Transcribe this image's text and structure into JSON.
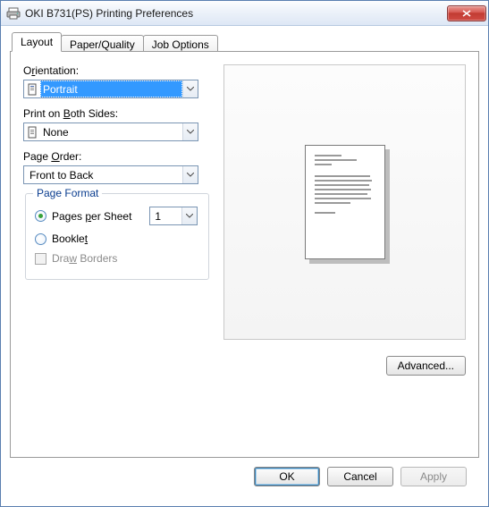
{
  "title": "OKI B731(PS) Printing Preferences",
  "tabs": {
    "layout": "Layout",
    "paper": "Paper/Quality",
    "job": "Job Options"
  },
  "orientation": {
    "label_pre": "O",
    "label_u": "r",
    "label_post": "ientation:",
    "value": "Portrait"
  },
  "duplex": {
    "label_pre": "Print on ",
    "label_u": "B",
    "label_post": "oth Sides:",
    "value": "None"
  },
  "order": {
    "label_pre": "Page ",
    "label_u": "O",
    "label_post": "rder:",
    "value": "Front to Back"
  },
  "format": {
    "legend": "Page Format",
    "pps": {
      "label_pre": "Pages ",
      "label_u": "p",
      "label_post": "er Sheet",
      "value": "1"
    },
    "booklet": {
      "label_pre": "Bookle",
      "label_u": "t",
      "label_post": ""
    },
    "borders": {
      "label_pre": "Dra",
      "label_u": "w",
      "label_post": " Borders"
    }
  },
  "buttons": {
    "advanced": "Advanced...",
    "ok": "OK",
    "cancel": "Cancel",
    "apply": "Apply"
  }
}
